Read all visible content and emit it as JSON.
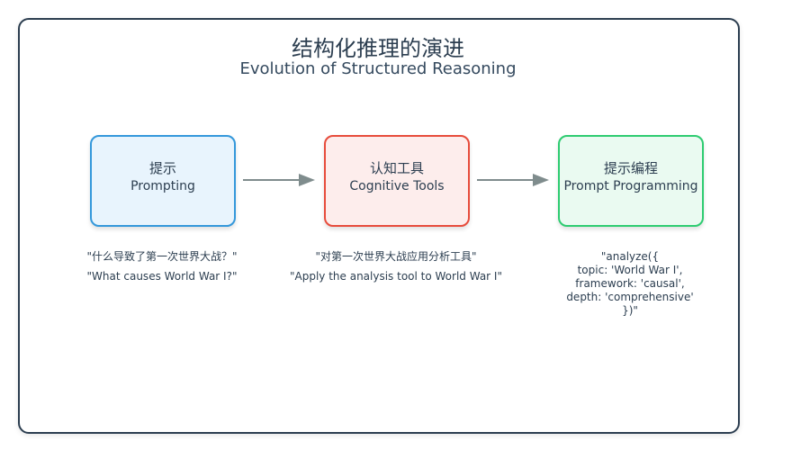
{
  "title": {
    "zh": "结构化推理的演进",
    "en": "Evolution of Structured Reasoning"
  },
  "nodes": [
    {
      "zh": "提示",
      "en": "Prompting"
    },
    {
      "zh": "认知工具",
      "en": "Cognitive Tools"
    },
    {
      "zh": "提示编程",
      "en": "Prompt Programming"
    }
  ],
  "examples": {
    "prompting": [
      "\"什么导致了第一次世界大战？\"",
      "\"What causes World War I?\""
    ],
    "cognitive_tools": [
      "\"对第一次世界大战应用分析工具\"",
      "\"Apply the analysis tool to World War I\""
    ],
    "prompt_programming": [
      "\"analyze({",
      "topic: 'World War I',",
      "framework: 'causal',",
      "depth: 'comprehensive'",
      "})\""
    ]
  },
  "colors": {
    "frame": "#2c3e50",
    "prompting_border": "#3498db",
    "prompting_fill": "#e8f4fd",
    "tools_border": "#e74c3c",
    "tools_fill": "#fdedec",
    "programming_border": "#2ecc71",
    "programming_fill": "#eafaf1",
    "arrow": "#7f8c8d"
  }
}
